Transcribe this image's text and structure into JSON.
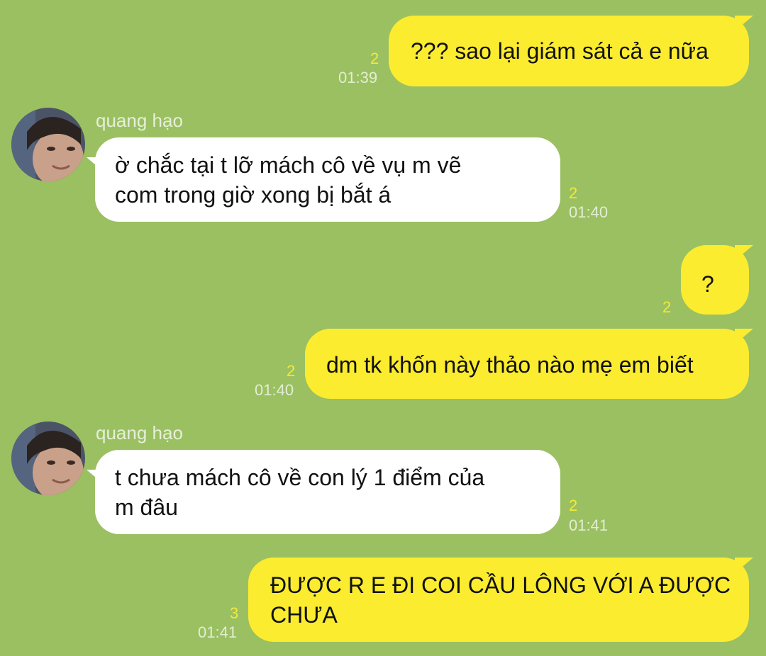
{
  "colors": {
    "background": "#9bc062",
    "outgoing_bubble": "#fbec2f",
    "incoming_bubble": "#ffffff",
    "read_count": "#f2ea3a",
    "timestamp": "#e3edd4"
  },
  "messages": [
    {
      "direction": "out",
      "text": "??? sao lại giám sát cả e nữa",
      "read_count": "2",
      "time": "01:39"
    },
    {
      "direction": "in",
      "sender": "quang hạo",
      "text": "ờ chắc tại t lỡ mách cô về vụ m vẽ\ncom trong giờ xong bị bắt á",
      "read_count": "2",
      "time": "01:40"
    },
    {
      "direction": "out",
      "text": "?",
      "read_count": "2",
      "time": ""
    },
    {
      "direction": "out",
      "text": "dm tk khốn này thảo nào mẹ em biết",
      "read_count": "2",
      "time": "01:40"
    },
    {
      "direction": "in",
      "sender": "quang hạo",
      "text": "t chưa mách cô về con lý 1 điểm của\nm đâu",
      "read_count": "2",
      "time": "01:41"
    },
    {
      "direction": "out",
      "text": "ĐƯỢC R E ĐI COI CẦU LÔNG VỚI A ĐƯỢC\nCHƯA",
      "read_count": "3",
      "time": "01:41"
    }
  ]
}
